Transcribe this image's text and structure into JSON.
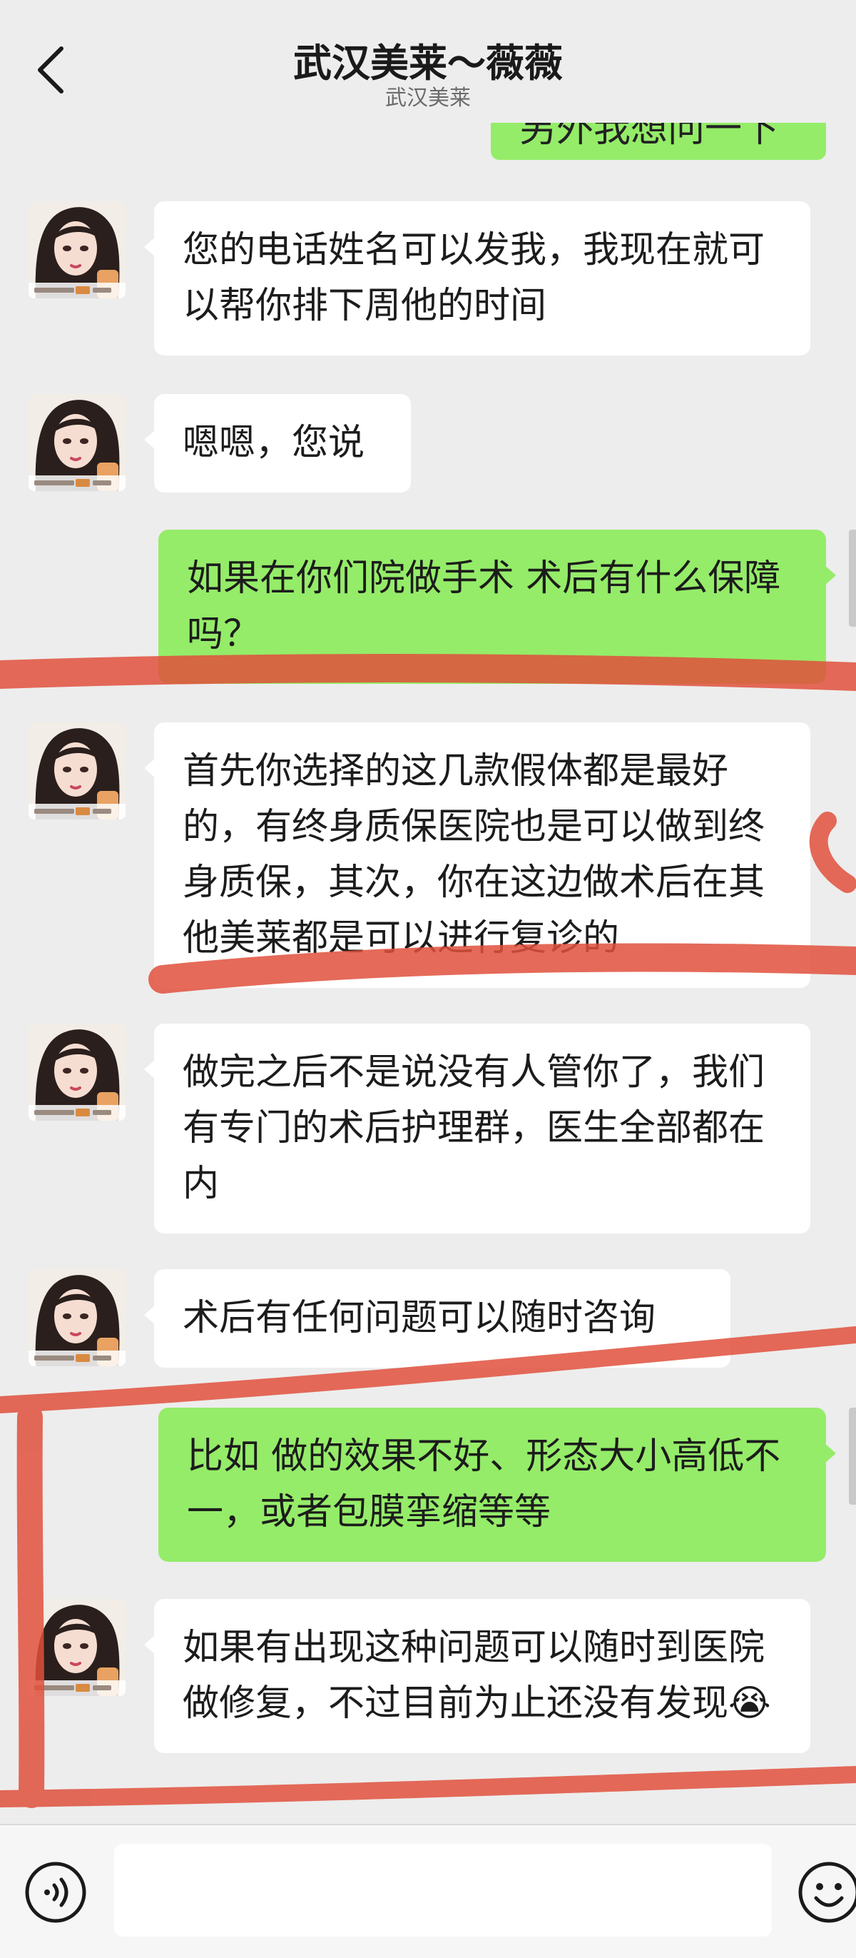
{
  "header": {
    "title": "武汉美莱～薇薇",
    "subtitle": "武汉美莱",
    "back_icon": "chevron-left-icon"
  },
  "colors": {
    "background": "#ededed",
    "incoming_bubble": "#ffffff",
    "outgoing_bubble": "#95ec69",
    "annotation_marker": "#e0503c"
  },
  "messages": [
    {
      "from": "self",
      "text": "另外我想问一下",
      "partial": true
    },
    {
      "from": "agent",
      "text": "您的电话姓名可以发我，我现在就可以帮你排下周他的时间"
    },
    {
      "from": "agent",
      "text": "嗯嗯，您说"
    },
    {
      "from": "self",
      "text": "如果在你们院做手术 术后有什么保障吗？"
    },
    {
      "from": "agent",
      "text": "首先你选择的这几款假体都是最好的，有终身质保医院也是可以做到终身质保，其次，你在这边做术后在其他美莱都是可以进行复诊的"
    },
    {
      "from": "agent",
      "text": "做完之后不是说没有人管你了，我们有专门的术后护理群，医生全部都在内"
    },
    {
      "from": "agent",
      "text": "术后有任何问题可以随时咨询"
    },
    {
      "from": "self",
      "text": "比如 做的效果不好、形态大小高低不一，或者包膜挛缩等等"
    },
    {
      "from": "agent",
      "text": "如果有出现这种问题可以随时到医院做修复，不过目前为止还没有发现😭"
    }
  ],
  "input_bar": {
    "voice_icon": "voice-icon",
    "emoji_icon": "emoji-icon",
    "input_value": ""
  }
}
